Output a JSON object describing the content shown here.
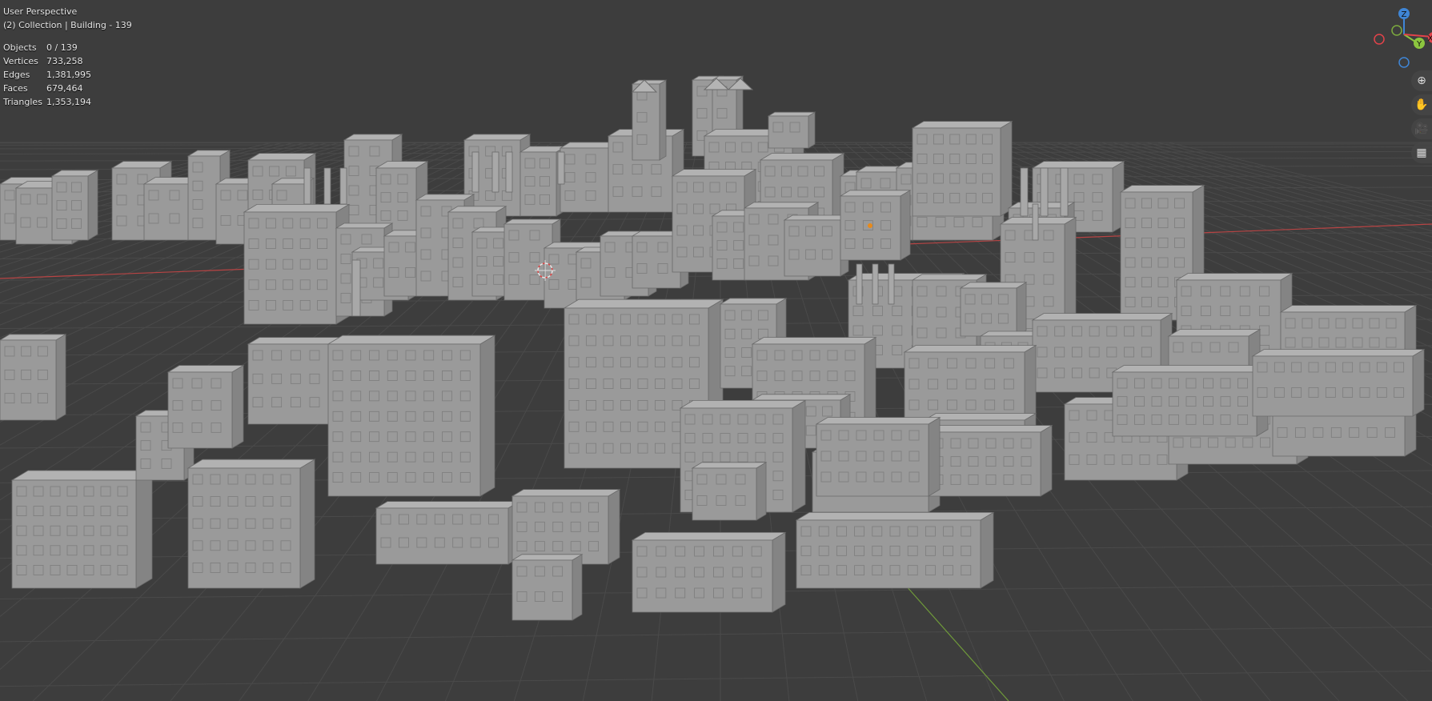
{
  "viewport": {
    "view_name": "User Perspective",
    "collection_label": "(2) Collection | Building - 139"
  },
  "stats": [
    {
      "label": "Objects",
      "value": "0 / 139"
    },
    {
      "label": "Vertices",
      "value": "733,258"
    },
    {
      "label": "Edges",
      "value": "1,381,995"
    },
    {
      "label": "Faces",
      "value": "679,464"
    },
    {
      "label": "Triangles",
      "value": "1,353,194"
    }
  ],
  "gizmo": {
    "axes": [
      "Z",
      "Y",
      "X"
    ],
    "colors": {
      "x": "#e2434a",
      "y": "#8cc63f",
      "z": "#3f86d6"
    }
  },
  "nav_tools": [
    {
      "name": "zoom-icon",
      "glyph": "⊕"
    },
    {
      "name": "pan-hand-icon",
      "glyph": "✋"
    },
    {
      "name": "camera-icon",
      "glyph": "🎥"
    },
    {
      "name": "grid-projection-icon",
      "glyph": "▦"
    }
  ],
  "colors": {
    "background": "#3d3d3d",
    "grid_line": "#4a4a4a",
    "x_axis_line": "#b84444",
    "y_axis_line": "#6f9a3a",
    "building_front": "#9a9a9a",
    "building_side": "#848484",
    "building_top": "#b2b2b2"
  }
}
